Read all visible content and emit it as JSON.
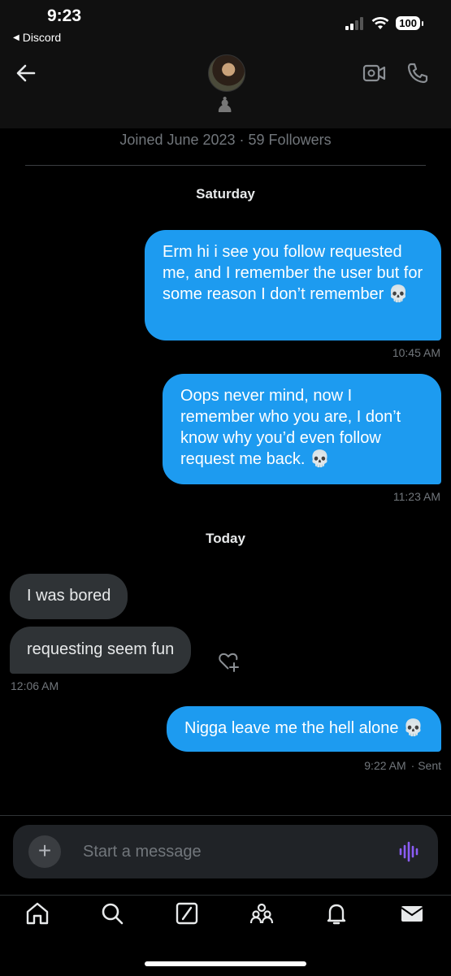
{
  "status_bar": {
    "time": "9:23",
    "back_app": "Discord",
    "battery": "100"
  },
  "profile": {
    "joined": "Joined June 2023 · 59 Followers",
    "badge": "♟"
  },
  "icons": {
    "back": "arrow-left-icon",
    "video": "video-call-icon",
    "phone": "phone-icon",
    "react": "heart-add-icon",
    "plus": "plus-icon",
    "voice": "voice-wave-icon"
  },
  "conversation": {
    "day1": "Saturday",
    "msg1": "Erm hi i see you follow requested me, and I remember the user but for some reason I don’t remember 💀",
    "msg1_time": "10:45 AM",
    "msg2": "Oops never mind, now I remember who you are, I don’t know why you’d even follow request me back.  💀",
    "msg2_time": "11:23 AM",
    "day2": "Today",
    "msg3": "I was bored",
    "msg4": "requesting seem fun",
    "msg4_time": "12:06 AM",
    "msg5": "Nigga leave me the hell alone 💀",
    "msg5_time": "9:22 AM",
    "msg5_status": "· Sent"
  },
  "composer": {
    "placeholder": "Start a message",
    "plus": "+"
  },
  "colors": {
    "sent_bubble": "#1d9bf0",
    "received_bubble": "#2f3336",
    "voice_accent": "#8b5cf6"
  }
}
